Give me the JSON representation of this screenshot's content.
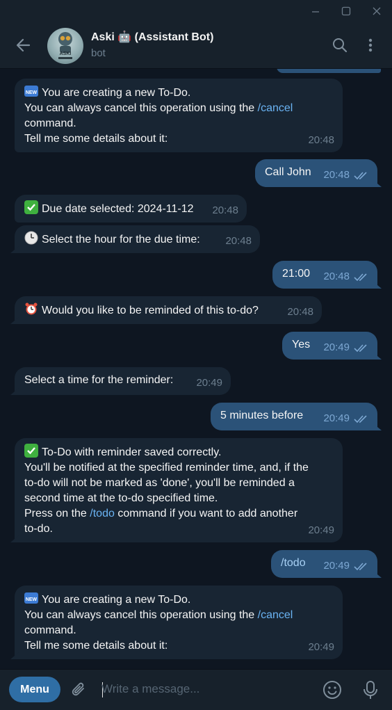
{
  "header": {
    "title": "Aski 🤖 (Assistant Bot)",
    "subtitle": "bot",
    "avatar_text": "ASKI"
  },
  "messages": [
    {
      "id": "m1",
      "dir": "in",
      "emoji": "new",
      "lines": [
        "You are creating a new To-Do.",
        "You can always cancel this operation using the "
      ],
      "link": "/cancel",
      "after": [
        "command.",
        "Tell me some details about it:"
      ],
      "time": "20:48"
    },
    {
      "id": "m2",
      "dir": "out",
      "text": "Call John",
      "time": "20:48"
    },
    {
      "id": "m3",
      "dir": "in",
      "emoji": "check",
      "text": "Due date selected: 2024-11-12",
      "time": "20:48"
    },
    {
      "id": "m4",
      "dir": "in",
      "emoji": "clock",
      "text": "Select the hour for the due time:",
      "time": "20:48"
    },
    {
      "id": "m5",
      "dir": "out",
      "text": "21:00",
      "time": "20:48"
    },
    {
      "id": "m6",
      "dir": "in",
      "emoji": "alarm",
      "text": "Would you like to be reminded of this to-do?",
      "time": "20:48"
    },
    {
      "id": "m7",
      "dir": "out",
      "text": "Yes",
      "time": "20:49"
    },
    {
      "id": "m8",
      "dir": "in",
      "text": "Select a time for the reminder:",
      "time": "20:49"
    },
    {
      "id": "m9",
      "dir": "out",
      "text": "5 minutes before",
      "time": "20:49"
    },
    {
      "id": "m10",
      "dir": "in",
      "emoji": "check",
      "lines": [
        "To-Do with reminder saved correctly.",
        "You'll be notified at the specified reminder time, and, if the",
        "to-do will not be marked as 'done', you'll be reminded a",
        "second time at the to-do specified time.",
        "Press on the "
      ],
      "link": "/todo",
      "link_tail": " command if you want to add another",
      "after": [
        "to-do."
      ],
      "time": "20:49"
    },
    {
      "id": "m11",
      "dir": "out",
      "text": "/todo",
      "is_link": true,
      "time": "20:49"
    },
    {
      "id": "m12",
      "dir": "in",
      "emoji": "new",
      "lines": [
        "You are creating a new To-Do.",
        "You can always cancel this operation using the "
      ],
      "link": "/cancel",
      "after": [
        "command.",
        "Tell me some details about it:"
      ],
      "time": "20:49"
    }
  ],
  "composer": {
    "menu_label": "Menu",
    "placeholder": "Write a message..."
  },
  "colors": {
    "background": "#0e1621",
    "incoming": "#182533",
    "outgoing": "#2b5278",
    "link": "#6ab3f3",
    "menu_button": "#2f6ea5"
  },
  "icons": [
    "back-arrow-icon",
    "search-icon",
    "more-vert-icon",
    "attach-icon",
    "emoji-icon",
    "microphone-icon",
    "double-check-icon",
    "minimize-icon",
    "maximize-icon",
    "close-icon"
  ]
}
